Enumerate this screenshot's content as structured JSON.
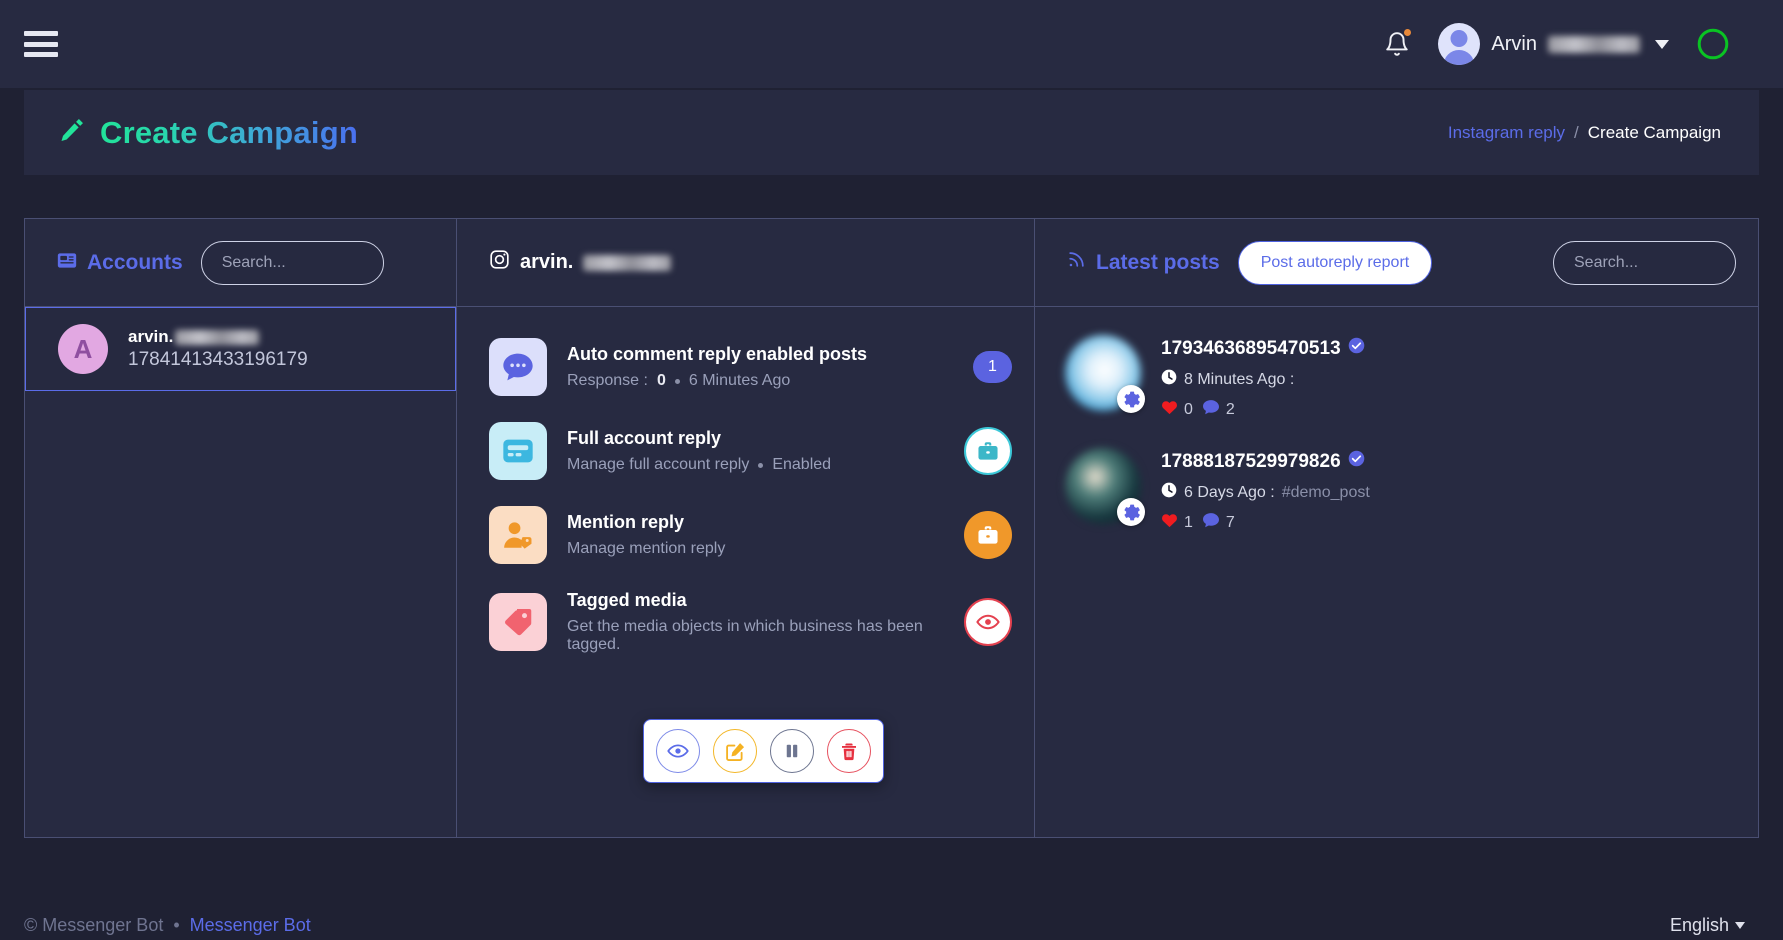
{
  "topnav": {
    "menu_icon": "hamburger-icon",
    "notification_icon": "bell-icon",
    "user_name": "Arvin",
    "user_name_blurred": true,
    "theme_toggle_icon": "dark-mode-toggle-icon",
    "theme_toggle_color": "#0ac323"
  },
  "page": {
    "title": "Create Campaign",
    "title_icon": "pen-edit-icon",
    "breadcrumb": {
      "parent": "Instagram reply",
      "separator": "/",
      "current": "Create Campaign"
    }
  },
  "accounts_panel": {
    "title": "Accounts",
    "title_icon": "address-book-icon",
    "search_placeholder": "Search...",
    "search_value": "",
    "items": [
      {
        "avatar_letter": "A",
        "name": "arvin.",
        "name_blurred": true,
        "id": "17841413433196179",
        "selected": true
      }
    ]
  },
  "detail_panel": {
    "title": "arvin.",
    "title_icon": "instagram-icon",
    "title_blurred": true,
    "items": [
      {
        "icon": "comment-dots-icon",
        "tile_class": "lavender",
        "title": "Auto comment reply enabled posts",
        "sub_label": "Response :",
        "sub_value": "0",
        "sub_time": "6 Minutes Ago",
        "badge_type": "count",
        "badge_value": "1"
      },
      {
        "icon": "id-card-icon",
        "tile_class": "cyan",
        "title": "Full account reply",
        "sub_label": "Manage full account reply",
        "sub_status": "Enabled",
        "badge_type": "briefcase-teal",
        "badge_icon": "briefcase-icon"
      },
      {
        "icon": "user-tag-icon",
        "tile_class": "peach",
        "title": "Mention reply",
        "sub_label": "Manage mention reply",
        "badge_type": "briefcase-orange",
        "badge_icon": "briefcase-icon"
      },
      {
        "icon": "tag-icon",
        "tile_class": "pink",
        "title": "Tagged media",
        "sub_label": "Get the media objects in which business has been tagged.",
        "badge_type": "eye-red",
        "badge_icon": "eye-icon"
      }
    ],
    "action_popup": {
      "visible": true,
      "buttons": [
        {
          "name": "view",
          "icon": "eye-icon",
          "color": "#5b6ce8"
        },
        {
          "name": "edit",
          "icon": "pencil-square-icon",
          "color": "#f5b223"
        },
        {
          "name": "pause",
          "icon": "pause-icon",
          "color": "#6d7590"
        },
        {
          "name": "delete",
          "icon": "trash-icon",
          "color": "#e6303f"
        }
      ]
    }
  },
  "posts_panel": {
    "title": "Latest posts",
    "title_icon": "rss-feed-icon",
    "report_button": "Post autoreply report",
    "search_placeholder": "Search...",
    "search_value": "",
    "posts": [
      {
        "id": "17934636895470513",
        "verified": true,
        "time_icon": "clock-icon",
        "time": "8 Minutes Ago :",
        "caption": "",
        "likes_icon": "heart-icon",
        "likes": "0",
        "comments_icon": "comment-icon",
        "comments": "2",
        "settings_icon": "gear-icon",
        "thumb_class": "thumb-1"
      },
      {
        "id": "17888187529979826",
        "verified": true,
        "time_icon": "clock-icon",
        "time": "6 Days Ago :",
        "caption": "#demo_post",
        "likes_icon": "heart-icon",
        "likes": "1",
        "comments_icon": "comment-icon",
        "comments": "7",
        "settings_icon": "gear-icon",
        "thumb_class": "thumb-2"
      }
    ]
  },
  "footer": {
    "copyright": "© Messenger Bot",
    "separator": "•",
    "brand_link": "Messenger Bot",
    "language": "English"
  }
}
